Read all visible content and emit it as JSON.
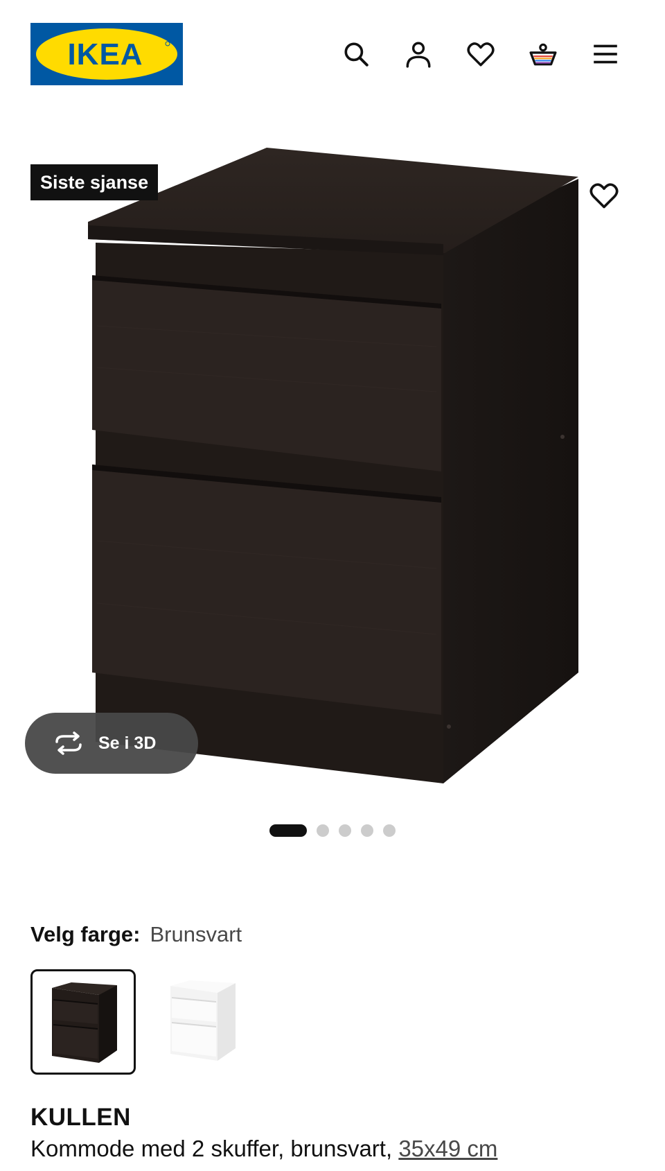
{
  "header": {
    "logo_text": "IKEA",
    "icons": [
      "search-icon",
      "user-icon",
      "heart-icon",
      "basket-icon",
      "menu-icon"
    ],
    "brand_blue": "#0058A3",
    "brand_yellow": "#FFDB00"
  },
  "gallery": {
    "badge": "Siste sjanse",
    "view_3d_label": "Se i 3D",
    "slide_count": 5,
    "active_slide": 1
  },
  "color_picker": {
    "label": "Velg farge:",
    "selected": "Brunsvart",
    "options": [
      {
        "color": "#2a221f",
        "selected": true
      },
      {
        "color": "#f4f4f4",
        "selected": false
      }
    ]
  },
  "product": {
    "name": "KULLEN",
    "description": "Kommode med 2 skuffer, brunsvart, ",
    "size": "35x49 cm"
  }
}
